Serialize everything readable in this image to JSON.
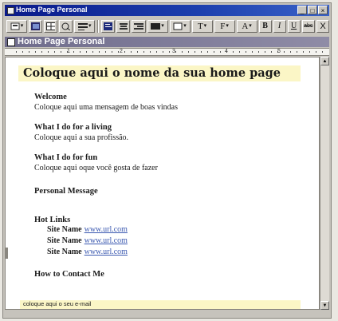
{
  "window": {
    "title": "Home Page Personal",
    "controls": [
      "_",
      "□",
      "×"
    ]
  },
  "toolbar": {
    "buttons": [
      {
        "name": "style-button",
        "icon": "style-icon"
      },
      {
        "name": "image-button",
        "icon": "image-icon"
      },
      {
        "name": "grid-button",
        "icon": "grid-icon"
      },
      {
        "name": "list-button",
        "icon": "list-icon"
      },
      {
        "name": "align-left-button",
        "icon": "align-left-icon"
      },
      {
        "name": "align-center-button",
        "icon": "align-center-icon"
      },
      {
        "name": "align-right-button",
        "icon": "align-right-icon"
      },
      {
        "name": "fill-color-button",
        "icon": "fill-color-icon"
      },
      {
        "name": "border-button",
        "icon": "border-icon"
      }
    ],
    "text_t_label": "T",
    "font_label": "F",
    "size_label": "A",
    "bold_label": "B",
    "italic_label": "I",
    "underline_label": "U",
    "strike_label": "abc",
    "close_label": "X"
  },
  "document": {
    "subtitle": "Home Page Personal",
    "heading": "Coloque aqui o nome da sua home page",
    "sections": [
      {
        "title": "Welcome",
        "body": "Coloque aqui uma mensagem de boas vindas"
      },
      {
        "title": "What I do for a living",
        "body": "Coloque aqui a sua profissão."
      },
      {
        "title": "What I do for fun",
        "body": "Coloque aqui oque você gosta de fazer"
      },
      {
        "title": "Personal Message",
        "body": ""
      }
    ],
    "hot_links": {
      "title": "Hot Links",
      "items": [
        {
          "name": "Site Name",
          "url": "www.url.com"
        },
        {
          "name": "Site Name",
          "url": "www.url.com"
        },
        {
          "name": "Site Name",
          "url": "www.url.com"
        }
      ]
    },
    "contact_title": "How to Contact Me",
    "email_placeholder": "coloque aqui o seu e-mail"
  },
  "ruler": {
    "numbers": [
      "1",
      "2",
      "3",
      "4",
      "5"
    ]
  },
  "colors": {
    "title_bar": "#1c3fae",
    "subtitle_bar": "#7e7b98",
    "highlight": "#fbf6c6",
    "link": "#3a58b0"
  }
}
